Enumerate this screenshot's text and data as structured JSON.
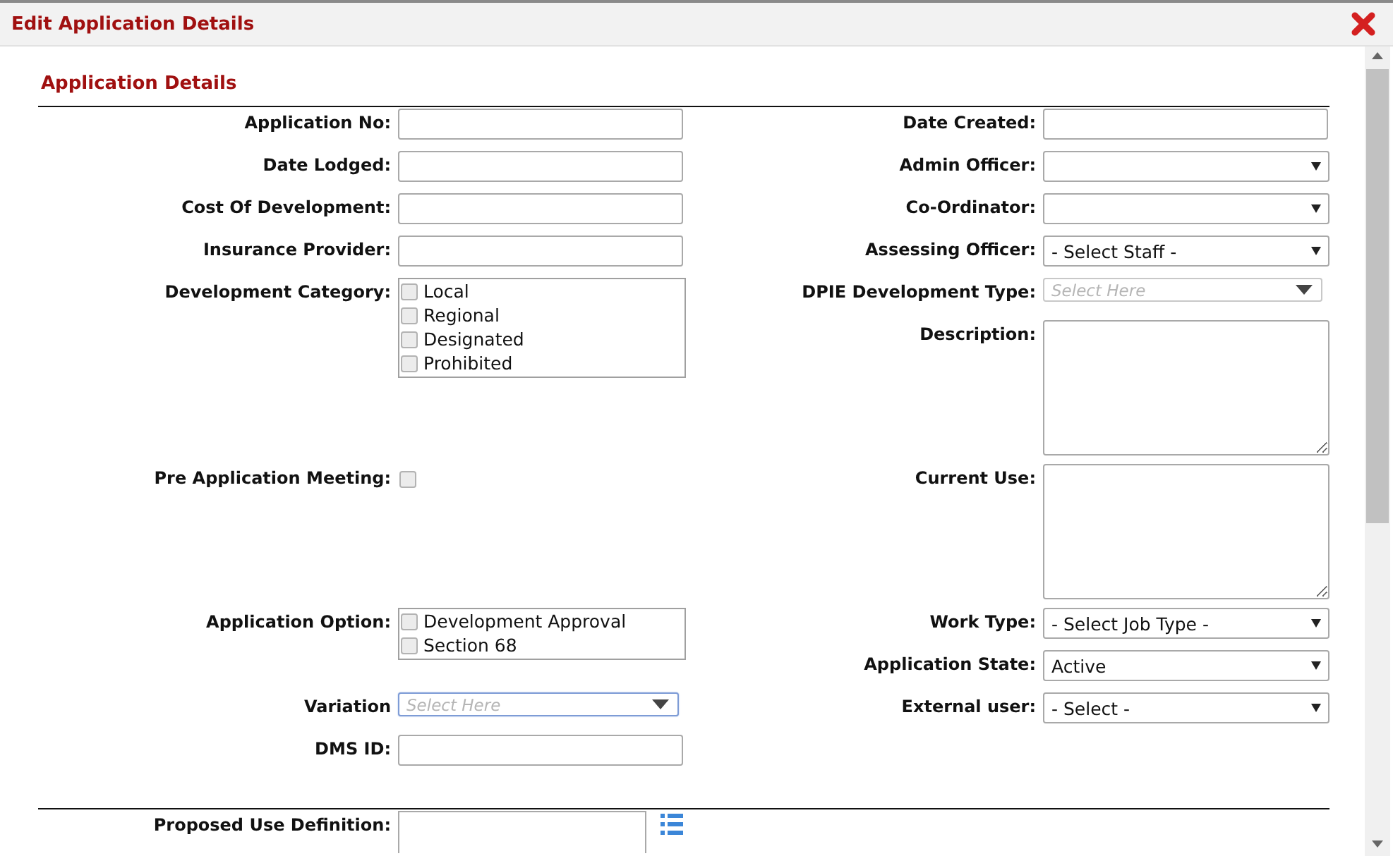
{
  "dialog": {
    "title": "Edit Application Details"
  },
  "section_title": "Application Details",
  "rows": [
    {
      "left": [
        {
          "label": "Application No:",
          "kind": "text"
        }
      ],
      "right": [
        {
          "label": "Date Created:",
          "kind": "text"
        }
      ]
    },
    {
      "left": [
        {
          "label": "Date Lodged:",
          "kind": "text"
        }
      ],
      "right": [
        {
          "label": "Admin Officer:",
          "kind": "select"
        }
      ]
    },
    {
      "left": [
        {
          "label": "Cost Of Development:",
          "kind": "text"
        }
      ],
      "right": [
        {
          "label": "Co-Ordinator:",
          "kind": "select"
        }
      ]
    },
    {
      "left": [
        {
          "label": "Insurance Provider:",
          "kind": "text"
        }
      ],
      "right": [
        {
          "label": "Assessing Officer:",
          "kind": "select",
          "value": "- Select Staff -"
        }
      ]
    },
    {
      "left": [
        {
          "label": "Development Category:",
          "kind": "checklist",
          "options": [
            {
              "label": "Local",
              "checked": false
            },
            {
              "label": "Regional",
              "checked": false
            },
            {
              "label": "Designated",
              "checked": false
            },
            {
              "label": "Prohibited",
              "checked": false
            }
          ]
        }
      ],
      "right": [
        {
          "label": "DPIE Development Type:",
          "kind": "combo",
          "placeholder": "Select Here",
          "focused": false
        },
        {
          "label": "Description:",
          "kind": "textarea"
        }
      ]
    },
    {
      "left": [
        {
          "label": "Pre Application Meeting:",
          "kind": "checkbox",
          "checked": false
        }
      ],
      "right": [
        {
          "label": "Current Use:",
          "kind": "textarea"
        }
      ]
    },
    {
      "left": [
        {
          "label": "Application Option:",
          "kind": "checklist",
          "options": [
            {
              "label": "Development Approval",
              "checked": false
            },
            {
              "label": "Section 68",
              "checked": false
            }
          ]
        }
      ],
      "right": [
        {
          "label": "Work Type:",
          "kind": "select",
          "value": "- Select Job Type -"
        },
        {
          "label": "Application State:",
          "kind": "select",
          "value": "Active"
        }
      ]
    },
    {
      "left": [
        {
          "label": "Variation",
          "kind": "combo",
          "placeholder": "Select Here",
          "focused": true
        }
      ],
      "right": [
        {
          "label": "External user:",
          "kind": "select",
          "value": "- Select -"
        }
      ]
    },
    {
      "left": [
        {
          "label": "DMS ID:",
          "kind": "text"
        }
      ],
      "right": []
    }
  ],
  "bottom_fields": [
    {
      "label": "Proposed Use Definition:",
      "kind": "text_list"
    }
  ]
}
